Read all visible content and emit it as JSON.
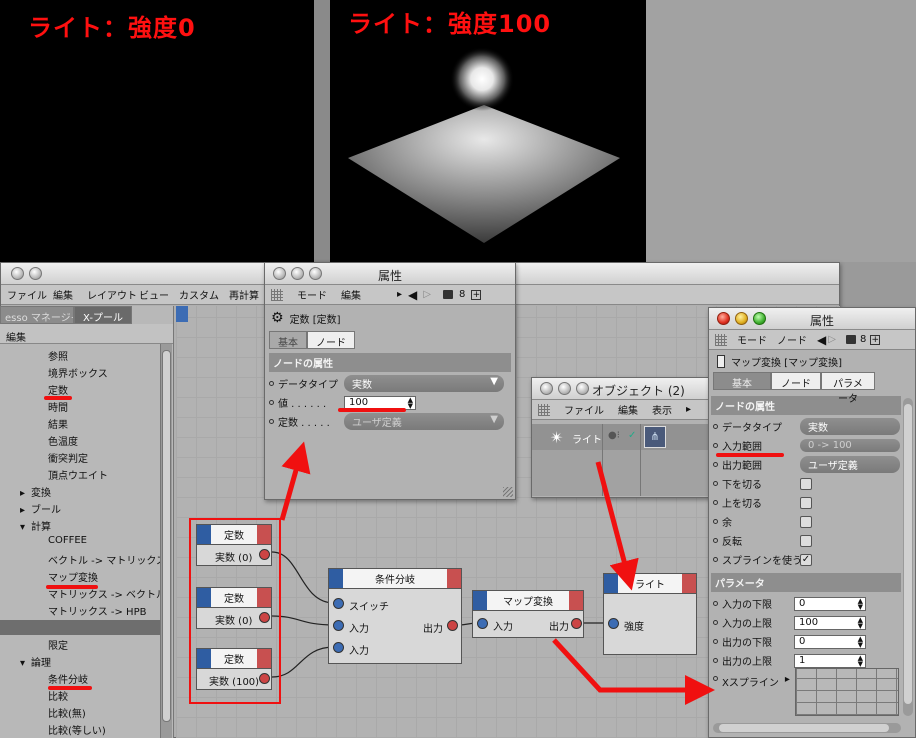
{
  "renders": {
    "left_caption": "ライト：強度0",
    "right_caption": "ライト：強度100"
  },
  "xpresso_window": {
    "menu": [
      "ファイル",
      "編集",
      "レイアウト",
      "ビュー",
      "カスタム",
      "再計算"
    ],
    "tabs": [
      "esso マネージャ",
      "X-プール"
    ],
    "panel_header": "編集",
    "tree": [
      {
        "label": "参照",
        "indent": 2
      },
      {
        "label": "境界ボックス",
        "indent": 2
      },
      {
        "label": "定数",
        "indent": 2
      },
      {
        "label": "時間",
        "indent": 2
      },
      {
        "label": "結果",
        "indent": 2
      },
      {
        "label": "色温度",
        "indent": 2
      },
      {
        "label": "衝突判定",
        "indent": 2
      },
      {
        "label": "頂点ウエイト",
        "indent": 2
      },
      {
        "label": "変換",
        "indent": 1,
        "arrow": "▸"
      },
      {
        "label": "ブール",
        "indent": 1,
        "arrow": "▸"
      },
      {
        "label": "計算",
        "indent": 1,
        "arrow": "▾"
      },
      {
        "label": "COFFEE",
        "indent": 2
      },
      {
        "label": "ベクトル -> マトリックス",
        "indent": 2
      },
      {
        "label": "マップ変換",
        "indent": 2
      },
      {
        "label": "マトリックス -> ベクトル",
        "indent": 2
      },
      {
        "label": "マトリックス -> HPB",
        "indent": 2
      },
      {
        "label": "",
        "indent": 2,
        "selected": true
      },
      {
        "label": "限定",
        "indent": 2
      },
      {
        "label": "論理",
        "indent": 1,
        "arrow": "▾"
      },
      {
        "label": "条件分岐",
        "indent": 2
      },
      {
        "label": "比較",
        "indent": 2
      },
      {
        "label": "比較(無)",
        "indent": 2
      },
      {
        "label": "比較(等しい)",
        "indent": 2
      }
    ]
  },
  "nodes": {
    "const1": {
      "title": "定数",
      "port": "実数 (0)"
    },
    "const2": {
      "title": "定数",
      "port": "実数 (0)"
    },
    "const3": {
      "title": "定数",
      "port": "実数 (100)"
    },
    "condition": {
      "title": "条件分岐",
      "in1": "スイッチ",
      "in2": "入力",
      "in3": "入力",
      "out": "出力"
    },
    "mapper": {
      "title": "マップ変換",
      "in": "入力",
      "out": "出力"
    },
    "light": {
      "title": "ライト",
      "in": "強度"
    }
  },
  "attr_window_1": {
    "title": "属性",
    "menu": [
      "モード",
      "編集"
    ],
    "object_name": "定数 [定数]",
    "tabs": [
      "基本",
      "ノード"
    ],
    "section": "ノードの属性",
    "fields": [
      {
        "label": "データタイプ",
        "value": "実数",
        "kind": "dropdown"
      },
      {
        "label": "値",
        "value": "100",
        "kind": "number"
      },
      {
        "label": "定数",
        "value": "ユーザ定義",
        "kind": "dropdown_dim"
      }
    ]
  },
  "object_window": {
    "title": "オブジェクト (2)",
    "menu": [
      "ファイル",
      "編集",
      "表示"
    ],
    "object": "ライト"
  },
  "attr_window_2": {
    "title": "属性",
    "menu": [
      "モード",
      "ノード"
    ],
    "object_name": "マップ変換 [マップ変換]",
    "tabs": [
      "基本",
      "ノード",
      "パラメータ"
    ],
    "section1": "ノードの属性",
    "fields1": [
      {
        "label": "データタイプ",
        "value": "実数",
        "kind": "dropdown"
      },
      {
        "label": "入力範囲",
        "value": "0 -> 100",
        "kind": "dropdown_dim"
      },
      {
        "label": "出力範囲",
        "value": "ユーザ定義",
        "kind": "dropdown"
      },
      {
        "label": "下を切る",
        "kind": "checkbox",
        "checked": false
      },
      {
        "label": "上を切る",
        "kind": "checkbox",
        "checked": false
      },
      {
        "label": "余",
        "kind": "checkbox",
        "checked": false
      },
      {
        "label": "反転",
        "kind": "checkbox",
        "checked": false
      },
      {
        "label": "スプラインを使う",
        "kind": "checkbox",
        "checked": true
      }
    ],
    "section2": "パラメータ",
    "fields2": [
      {
        "label": "入力の下限",
        "value": "0"
      },
      {
        "label": "入力の上限",
        "value": "100"
      },
      {
        "label": "出力の下限",
        "value": "0"
      },
      {
        "label": "出力の上限",
        "value": "1"
      }
    ],
    "spline_label": "Xスプライン"
  }
}
